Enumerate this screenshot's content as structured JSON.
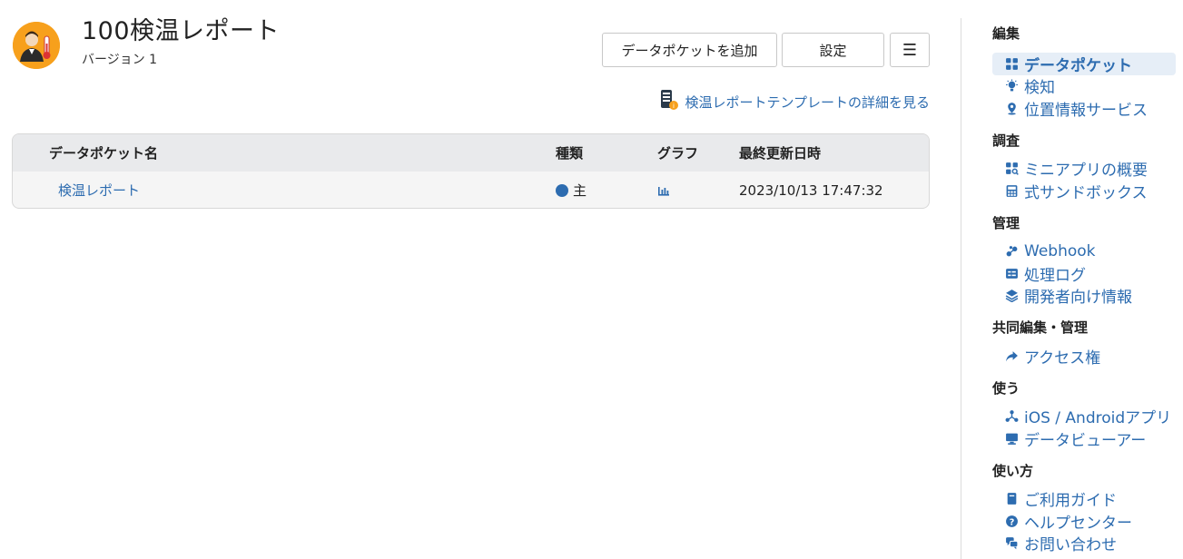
{
  "header": {
    "title": "100検温レポート",
    "version": "バージョン 1"
  },
  "toolbar": {
    "add_label": "データポケットを追加",
    "settings_label": "設定",
    "menu_label": "☰"
  },
  "template_link": "検温レポートテンプレートの詳細を見る",
  "table": {
    "headers": [
      "データポケット名",
      "種類",
      "グラフ",
      "最終更新日時"
    ],
    "rows": [
      {
        "name": "検温レポート",
        "kind": "主",
        "updated": "2023/10/13 17:47:32"
      }
    ]
  },
  "sidebar": {
    "sections": [
      {
        "title": "編集",
        "items": [
          {
            "label": "データポケット",
            "icon": "grid-icon",
            "active": true
          },
          {
            "label": "検知",
            "icon": "bulb-icon"
          },
          {
            "label": "位置情報サービス",
            "icon": "map-pin-icon"
          }
        ]
      },
      {
        "title": "調査",
        "items": [
          {
            "label": "ミニアプリの概要",
            "icon": "apps-search-icon"
          },
          {
            "label": "式サンドボックス",
            "icon": "calculator-icon"
          }
        ]
      },
      {
        "title": "管理",
        "items": [
          {
            "label": "Webhook",
            "icon": "webhook-icon"
          },
          {
            "label": "処理ログ",
            "icon": "log-icon"
          },
          {
            "label": "開発者向け情報",
            "icon": "layers-icon"
          }
        ]
      },
      {
        "title": "共同編集・管理",
        "items": [
          {
            "label": "アクセス権",
            "icon": "share-arrow-icon"
          }
        ]
      },
      {
        "title": "使う",
        "items": [
          {
            "label": "iOS / Androidアプリ",
            "icon": "network-icon"
          },
          {
            "label": "データビューアー",
            "icon": "monitor-icon"
          }
        ]
      },
      {
        "title": "使い方",
        "items": [
          {
            "label": "ご利用ガイド",
            "icon": "book-icon"
          },
          {
            "label": "ヘルプセンター",
            "icon": "help-icon"
          },
          {
            "label": "お問い合わせ",
            "icon": "chat-icon"
          }
        ]
      }
    ]
  },
  "colors": {
    "accent": "#2d6cb0",
    "app_icon_bg": "#f7a01c"
  }
}
